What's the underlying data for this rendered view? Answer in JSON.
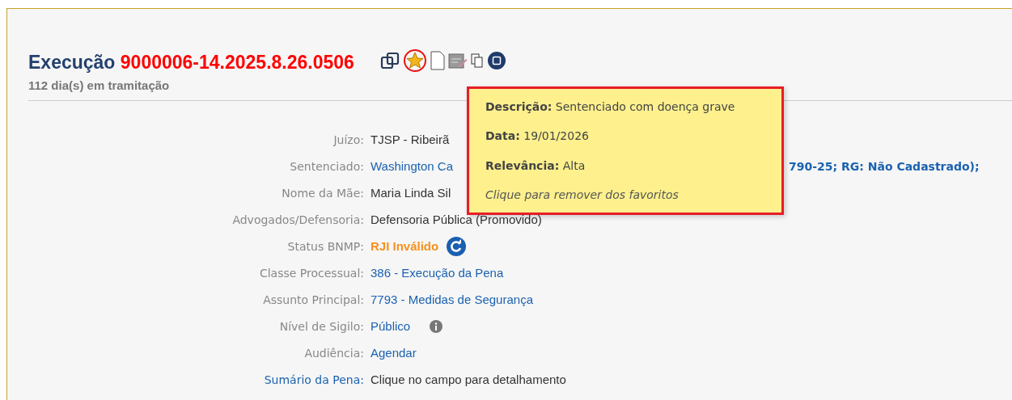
{
  "header": {
    "prefix": "Execução",
    "number": "9000006-14.2025.8.26.0506",
    "subtitle": "112 dia(s) em tramitação",
    "favorite": true
  },
  "fields": [
    {
      "label": "Juízo:",
      "kind": "plain",
      "parts": [
        "TJSP - Ribeirã"
      ]
    },
    {
      "label": "Sentenciado:",
      "kind": "person",
      "parts": [
        "Washington Ca",
        "790-25; RG: Não Cadastrado);"
      ]
    },
    {
      "label": "Nome da Mãe:",
      "kind": "plain",
      "parts": [
        "Maria Linda Sil"
      ]
    },
    {
      "label": "Advogados/Defensoria:",
      "kind": "plain",
      "parts": [
        "Defensoria Pública (Promovido)"
      ]
    },
    {
      "label": "Status BNMP:",
      "kind": "status",
      "parts": [
        "RJI Inválido"
      ]
    },
    {
      "label": "Classe Processual:",
      "kind": "link",
      "parts": [
        "386 - Execução da Pena"
      ]
    },
    {
      "label": "Assunto Principal:",
      "kind": "link",
      "parts": [
        "7793 - Medidas de Segurança"
      ]
    },
    {
      "label": "Nível de Sigilo:",
      "kind": "secrecy",
      "parts": [
        "Público"
      ]
    },
    {
      "label": "Audiência:",
      "kind": "link",
      "parts": [
        "Agendar"
      ]
    },
    {
      "label": "Sumário da Pena:",
      "kind": "summary",
      "parts": [
        "Clique no campo para detalhamento"
      ]
    }
  ],
  "tooltip": {
    "lines": [
      "**Descrição:** Sentenciado com doença grave",
      "**Data:** 19/01/2026",
      "**Relevância:** Alta"
    ],
    "hint": "Clique para remover dos favoritos"
  }
}
